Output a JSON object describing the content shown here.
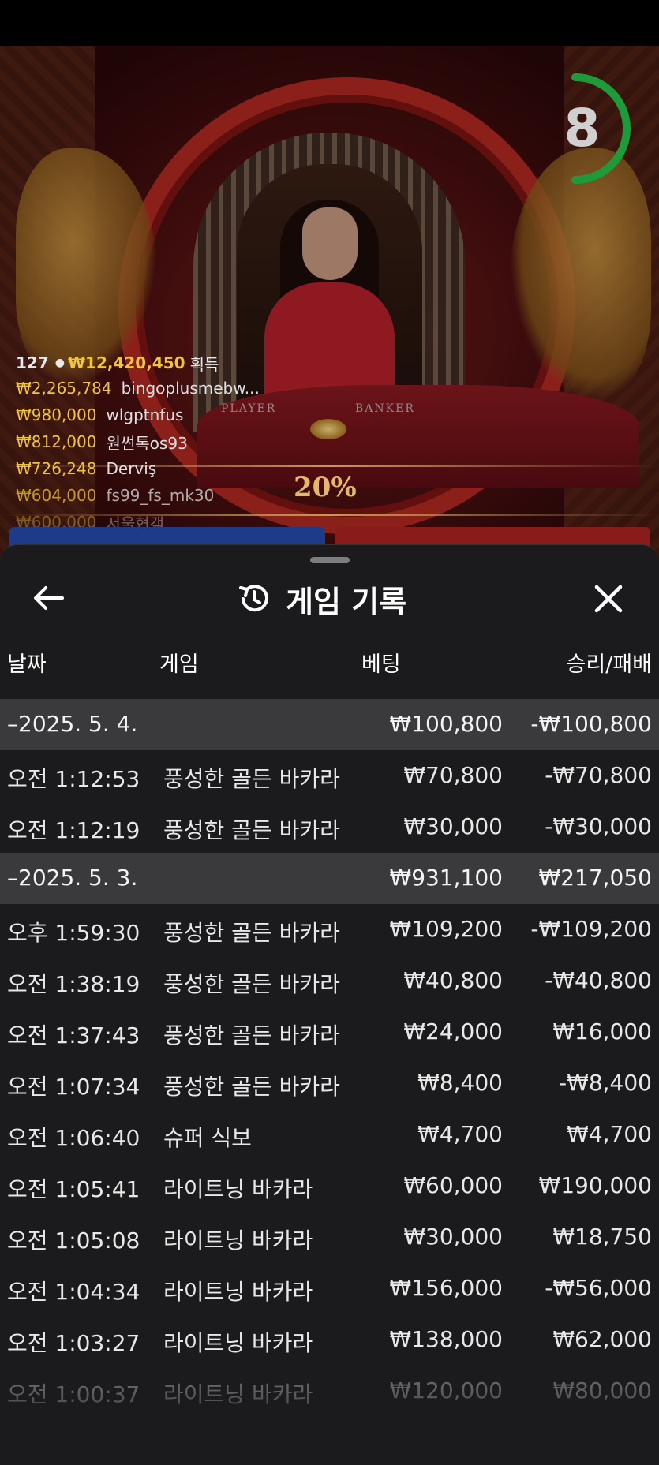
{
  "timer": {
    "value": "8"
  },
  "table_labels": {
    "player": "PLAYER",
    "banker": "BANKER"
  },
  "side_bet_percent": "20%",
  "winners": {
    "count": "127",
    "total": "₩12,420,450",
    "suffix": "획득",
    "list": [
      {
        "amount": "₩2,265,784",
        "name": "bingoplusmebw..."
      },
      {
        "amount": "₩980,000",
        "name": "wlgptnfus"
      },
      {
        "amount": "₩812,000",
        "name": "원썬톡os93"
      },
      {
        "amount": "₩726,248",
        "name": "Derviş"
      },
      {
        "amount": "₩604,000",
        "name": "fs99_fs_mk30"
      },
      {
        "amount": "₩600,000",
        "name": "서울협객"
      }
    ]
  },
  "history": {
    "title": "게임 기록",
    "columns": {
      "date": "날짜",
      "game": "게임",
      "bet": "베팅",
      "result": "승리/패배"
    },
    "rows": [
      {
        "type": "group",
        "time": "–2025. 5. 4.",
        "game": "",
        "bet": "₩100,800",
        "result": "-₩100,800"
      },
      {
        "type": "item",
        "time": "오전 1:12:53",
        "game": "풍성한 골든 바카라",
        "bet": "₩70,800",
        "result": "-₩70,800"
      },
      {
        "type": "item",
        "time": "오전 1:12:19",
        "game": "풍성한 골든 바카라",
        "bet": "₩30,000",
        "result": "-₩30,000"
      },
      {
        "type": "group",
        "time": "–2025. 5. 3.",
        "game": "",
        "bet": "₩931,100",
        "result": "₩217,050"
      },
      {
        "type": "item",
        "time": "오후 1:59:30",
        "game": "풍성한 골든 바카라",
        "bet": "₩109,200",
        "result": "-₩109,200"
      },
      {
        "type": "item",
        "time": "오전 1:38:19",
        "game": "풍성한 골든 바카라",
        "bet": "₩40,800",
        "result": "-₩40,800"
      },
      {
        "type": "item",
        "time": "오전 1:37:43",
        "game": "풍성한 골든 바카라",
        "bet": "₩24,000",
        "result": "₩16,000"
      },
      {
        "type": "item",
        "time": "오전 1:07:34",
        "game": "풍성한 골든 바카라",
        "bet": "₩8,400",
        "result": "-₩8,400"
      },
      {
        "type": "item",
        "time": "오전 1:06:40",
        "game": "슈퍼 식보",
        "bet": "₩4,700",
        "result": "₩4,700"
      },
      {
        "type": "item",
        "time": "오전 1:05:41",
        "game": "라이트닝 바카라",
        "bet": "₩60,000",
        "result": "₩190,000"
      },
      {
        "type": "item",
        "time": "오전 1:05:08",
        "game": "라이트닝 바카라",
        "bet": "₩30,000",
        "result": "₩18,750"
      },
      {
        "type": "item",
        "time": "오전 1:04:34",
        "game": "라이트닝 바카라",
        "bet": "₩156,000",
        "result": "-₩56,000"
      },
      {
        "type": "item",
        "time": "오전 1:03:27",
        "game": "라이트닝 바카라",
        "bet": "₩138,000",
        "result": "₩62,000"
      },
      {
        "type": "item",
        "time": "오전 1:00:37",
        "game": "라이트닝 바카라",
        "bet": "₩120,000",
        "result": "₩80,000"
      }
    ]
  }
}
